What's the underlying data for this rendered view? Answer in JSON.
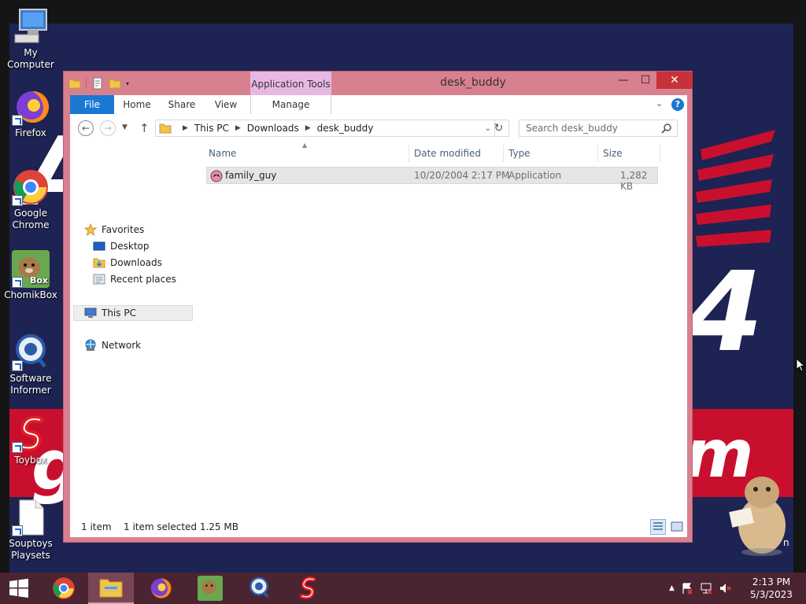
{
  "desktop": {
    "icons": [
      {
        "label": "My Computer",
        "icon": "monitor-icon"
      },
      {
        "label": "Firefox",
        "icon": "firefox-icon"
      },
      {
        "label": "Google Chrome",
        "icon": "chrome-icon"
      },
      {
        "label": "ChomikBox",
        "icon": "hamster-icon"
      },
      {
        "label": "Software Informer",
        "icon": "magnifier-icon"
      },
      {
        "label": "Toybox",
        "icon": "toybox-icon"
      },
      {
        "label": "Souptoys Playsets",
        "icon": "blank-file-icon"
      }
    ],
    "hamster_badge_text": "Box",
    "wallpaper_text": {
      "g": "g",
      "m": "m",
      "four": "4",
      "a": "A",
      "n": "n"
    }
  },
  "window": {
    "title": "desk_buddy",
    "contextual_tab_group": "Application Tools",
    "controls": {
      "minimize": "—",
      "maximize": "☐",
      "close": "✕"
    },
    "ribbon_tabs": [
      "File",
      "Home",
      "Share",
      "View",
      "Manage"
    ],
    "help_label": "?",
    "address": {
      "crumbs": [
        "This PC",
        "Downloads",
        "desk_buddy"
      ]
    },
    "search": {
      "placeholder": "Search desk_buddy"
    },
    "nav_pane": {
      "favorites_label": "Favorites",
      "favorites": [
        "Desktop",
        "Downloads",
        "Recent places"
      ],
      "this_pc_label": "This PC",
      "network_label": "Network"
    },
    "columns": [
      "Name",
      "Date modified",
      "Type",
      "Size"
    ],
    "files": [
      {
        "name": "family_guy",
        "date_modified": "10/20/2004 2:17 PM",
        "type": "Application",
        "size": "1,282 KB"
      }
    ],
    "status": {
      "item_count": "1 item",
      "selection": "1 item selected  1.25 MB"
    }
  },
  "taskbar": {
    "apps": [
      "Chrome",
      "File Explorer",
      "Firefox",
      "ChomikBox",
      "Software Informer",
      "Toybox"
    ],
    "active_app": "File Explorer",
    "clock_time": "2:13 PM",
    "clock_date": "5/3/2023"
  },
  "colors": {
    "window_frame": "#d9808f",
    "close_button": "#c7323a",
    "file_tab": "#1a78d2",
    "contextual_tab": "#e8b8e4",
    "taskbar": "#4a2430"
  }
}
